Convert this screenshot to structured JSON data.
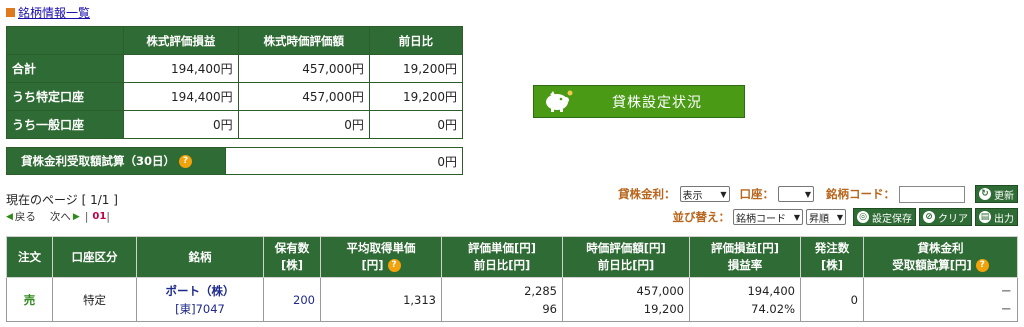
{
  "section_link": "銘柄情報一覧",
  "summary": {
    "headers": [
      "株式評価損益",
      "株式時価評価額",
      "前日比"
    ],
    "rows": [
      {
        "label": "合計",
        "values": [
          "194,400円",
          "457,000円",
          "19,200円"
        ]
      },
      {
        "label": "うち特定口座",
        "values": [
          "194,400円",
          "457,000円",
          "19,200円"
        ]
      },
      {
        "label": "うち一般口座",
        "values": [
          "0円",
          "0円",
          "0円"
        ]
      }
    ]
  },
  "lending_estimate": {
    "label": "貸株金利受取額試算（30日）",
    "value": "0円"
  },
  "lending_button": "貸株設定状況",
  "page_info": "現在のページ [ 1/1 ]",
  "pager": {
    "prev": "戻る",
    "next": "次へ",
    "current": "01"
  },
  "filters": {
    "lend_rate_label": "貸株金利：",
    "lend_rate_value": "表示",
    "account_label": "口座：",
    "account_value": "",
    "code_label": "銘柄コード：",
    "code_value": "",
    "refresh": "更新"
  },
  "sort": {
    "label": "並び替え：",
    "field": "銘柄コード",
    "order": "昇順",
    "save": "設定保存",
    "clear": "クリア",
    "print": "出力"
  },
  "table": {
    "headers": [
      "注文",
      "口座区分",
      "銘柄",
      "保有数\n[株]",
      "平均取得単価\n[円]",
      "評価単価[円]\n前日比[円]",
      "時価評価額[円]\n前日比[円]",
      "評価損益[円]\n損益率",
      "発注数\n[株]",
      "貸株金利\n受取額試算[円]"
    ],
    "rows": [
      {
        "order": "売",
        "account": "特定",
        "name": "ポート（株）",
        "code": "[東]7047",
        "qty": "200",
        "avg_cost": "1,313",
        "unit_price": "2,285",
        "unit_change": "96",
        "market_value": "457,000",
        "market_change": "19,200",
        "pl": "194,400",
        "pl_rate": "74.02%",
        "order_qty": "0",
        "lend_1": "－",
        "lend_2": "－"
      }
    ]
  }
}
